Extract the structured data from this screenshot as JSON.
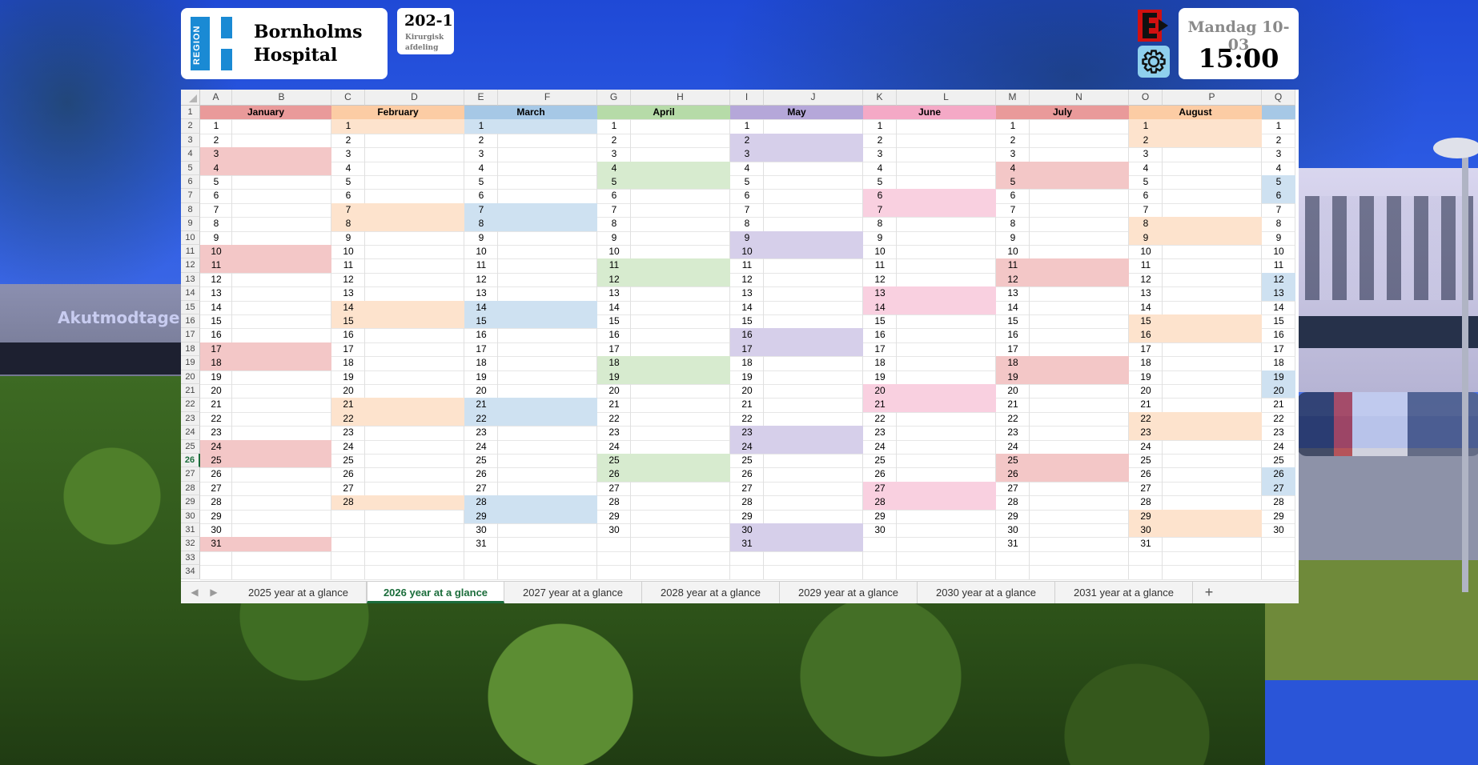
{
  "header": {
    "logo_text": "REGION",
    "hospital_name_line1": "Bornholms",
    "hospital_name_line2": "Hospital",
    "room_number": "202-1",
    "department_line1": "Kirurgisk",
    "department_line2": "afdeling",
    "date": "Mandag 10-03",
    "time": "15:00"
  },
  "background": {
    "sign_text": "Akutmodtagel"
  },
  "colors": {
    "January": "#e99a9a",
    "February": "#fccca4",
    "March": "#a6c8e6",
    "April": "#b6dba8",
    "May": "#b5a7d9",
    "June": "#f4a9c6",
    "July": "#e99a9a",
    "August": "#fccca4",
    "September": "#a6c8e6",
    "accent_green": "#1b6d3b"
  },
  "spreadsheet": {
    "columns": [
      "A",
      "B",
      "C",
      "D",
      "E",
      "F",
      "G",
      "H",
      "I",
      "J",
      "K",
      "L",
      "M",
      "N",
      "O",
      "P",
      "Q"
    ],
    "row_numbers": [
      1,
      2,
      3,
      4,
      5,
      6,
      7,
      8,
      9,
      10,
      11,
      12,
      13,
      14,
      15,
      16,
      17,
      18,
      19,
      20,
      21,
      22,
      23,
      24,
      25,
      26,
      27,
      28,
      29,
      30,
      31,
      32,
      33,
      34
    ],
    "selected_row": 26,
    "months": [
      {
        "name": "January",
        "days": 31,
        "weekend_days": [
          3,
          4,
          10,
          11,
          17,
          18,
          24,
          25,
          31
        ]
      },
      {
        "name": "February",
        "days": 28,
        "weekend_days": [
          1,
          7,
          8,
          14,
          15,
          21,
          22,
          28
        ]
      },
      {
        "name": "March",
        "days": 31,
        "weekend_days": [
          1,
          7,
          8,
          14,
          15,
          21,
          22,
          28,
          29
        ]
      },
      {
        "name": "April",
        "days": 30,
        "weekend_days": [
          4,
          5,
          11,
          12,
          18,
          19,
          25,
          26
        ]
      },
      {
        "name": "May",
        "days": 31,
        "weekend_days": [
          2,
          3,
          9,
          10,
          16,
          17,
          23,
          24,
          30,
          31
        ]
      },
      {
        "name": "June",
        "days": 30,
        "weekend_days": [
          6,
          7,
          13,
          14,
          20,
          21,
          27,
          28
        ]
      },
      {
        "name": "July",
        "days": 31,
        "weekend_days": [
          4,
          5,
          11,
          12,
          18,
          19,
          25,
          26
        ]
      },
      {
        "name": "August",
        "days": 31,
        "weekend_days": [
          1,
          2,
          8,
          9,
          15,
          16,
          22,
          23,
          29,
          30
        ]
      },
      {
        "name": "",
        "days": 30,
        "weekend_days": [
          5,
          6,
          12,
          13,
          19,
          20,
          26,
          27
        ]
      }
    ]
  },
  "tabs": [
    {
      "label": "2025 year at a glance",
      "active": false
    },
    {
      "label": "2026 year at a glance",
      "active": true
    },
    {
      "label": "2027 year at a glance",
      "active": false
    },
    {
      "label": "2028 year at a glance",
      "active": false
    },
    {
      "label": "2029 year at a glance",
      "active": false
    },
    {
      "label": "2030 year at a glance",
      "active": false
    },
    {
      "label": "2031 year at a glance",
      "active": false
    }
  ],
  "tab_controls": {
    "prev": "◀",
    "next": "▶",
    "add": "+"
  },
  "icons": {
    "exit": "exit-icon",
    "settings": "gear-icon"
  }
}
